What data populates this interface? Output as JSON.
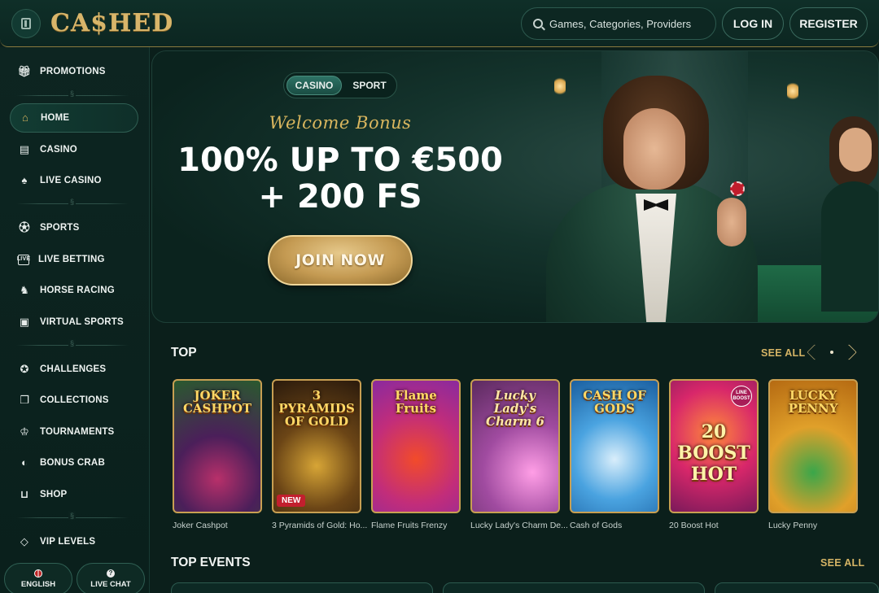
{
  "header": {
    "logo": "CA$HED",
    "search_placeholder": "Games, Categories, Providers",
    "login_label": "LOG IN",
    "register_label": "REGISTER"
  },
  "sidebar": {
    "items": [
      {
        "label": "PROMOTIONS",
        "icon": "gift-icon"
      },
      {
        "label": "HOME",
        "icon": "home-icon",
        "active": true
      },
      {
        "label": "CASINO",
        "icon": "slot-machine-icon"
      },
      {
        "label": "LIVE CASINO",
        "icon": "cards-icon"
      },
      {
        "label": "SPORTS",
        "icon": "soccer-ball-icon"
      },
      {
        "label": "LIVE BETTING",
        "icon": "live-icon"
      },
      {
        "label": "HORSE RACING",
        "icon": "horse-icon"
      },
      {
        "label": "VIRTUAL SPORTS",
        "icon": "virtual-sports-icon"
      },
      {
        "label": "CHALLENGES",
        "icon": "medal-icon"
      },
      {
        "label": "COLLECTIONS",
        "icon": "collections-icon"
      },
      {
        "label": "TOURNAMENTS",
        "icon": "trophy-icon"
      },
      {
        "label": "BONUS CRAB",
        "icon": "crab-icon"
      },
      {
        "label": "SHOP",
        "icon": "basket-icon"
      },
      {
        "label": "VIP LEVELS",
        "icon": "diamond-icon"
      }
    ],
    "language_label": "ENGLISH",
    "live_chat_label": "LIVE CHAT"
  },
  "hero": {
    "tabs": [
      "CASINO",
      "SPORT"
    ],
    "active_tab": "CASINO",
    "welcome": "Welcome Bonus",
    "headline_line1": "100% UP TO €500",
    "headline_line2": "+ 200 FS",
    "cta": "JOIN NOW"
  },
  "top": {
    "title": "TOP",
    "see_all": "SEE ALL",
    "games": [
      {
        "name": "Joker Cashpot",
        "art": "JOKER CASHPOT",
        "bg": "#3b6e3a"
      },
      {
        "name": "3 Pyramids of Gold: Ho...",
        "art": "3 PYRAMIDS OF GOLD",
        "bg": "#3a2a16",
        "badge": "NEW"
      },
      {
        "name": "Flame Fruits Frenzy",
        "art": "Flame Fruits",
        "bg": "#b53a9a"
      },
      {
        "name": "Lucky Lady's Charm De...",
        "art": "Lucky Lady's Charm 6",
        "bg": "#7a3f7a"
      },
      {
        "name": "Cash of Gods",
        "art": "CASH OF GODS",
        "bg": "#3a86c9"
      },
      {
        "name": "20 Boost Hot",
        "art": "20 BOOST HOT",
        "bg": "#c22a7a",
        "badge": "LINE BOOST"
      },
      {
        "name": "Lucky Penny",
        "art": "LUCKY PENNY",
        "bg": "#e0a02a"
      }
    ]
  },
  "top_events": {
    "title": "TOP EVENTS",
    "see_all": "SEE ALL"
  }
}
